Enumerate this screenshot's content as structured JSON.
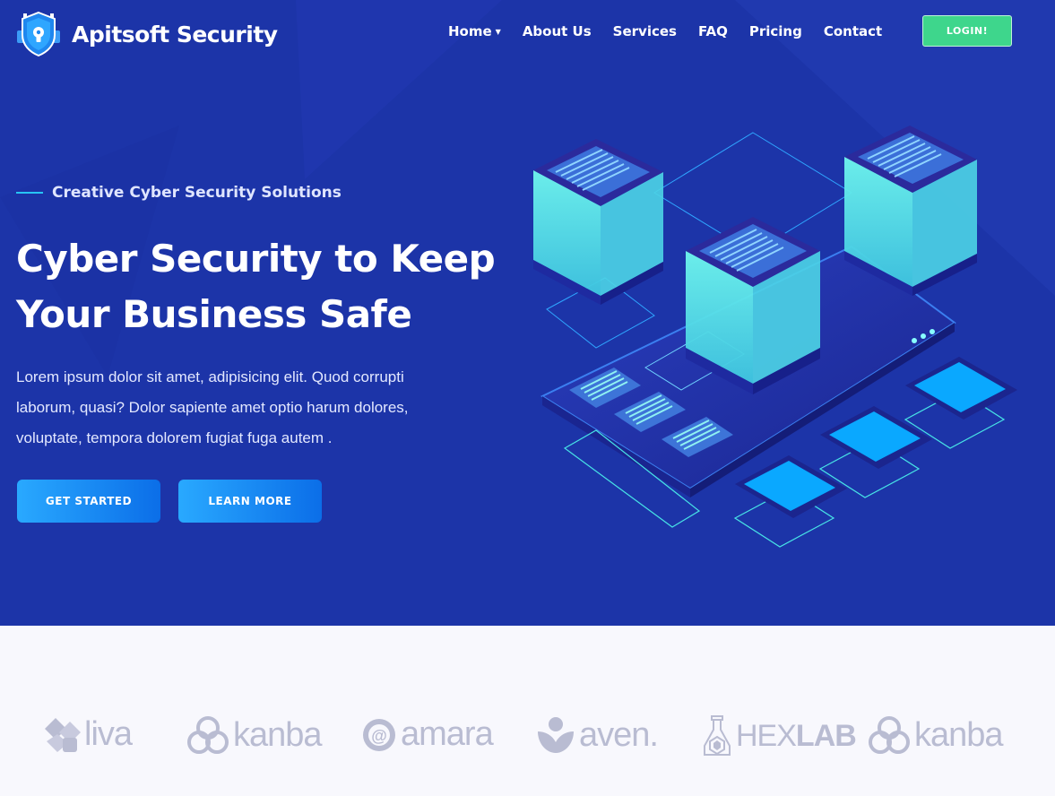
{
  "brand": {
    "name": "Apitsoft Security",
    "icon": "shield-lock-icon"
  },
  "nav": {
    "items": [
      {
        "label": "Home",
        "has_dropdown": true
      },
      {
        "label": "About Us"
      },
      {
        "label": "Services"
      },
      {
        "label": "FAQ"
      },
      {
        "label": "Pricing"
      },
      {
        "label": "Contact"
      }
    ],
    "login_label": "LOGIN!"
  },
  "hero": {
    "eyebrow": "Creative Cyber Security Solutions",
    "title_line1": "Cyber Security to Keep",
    "title_line2": "Your Business Safe",
    "paragraph_line1": "Lorem ipsum dolor sit amet, adipisicing elit. Quod corrupti",
    "paragraph_line2": "laborum, quasi? Dolor sapiente amet optio harum dolores,",
    "paragraph_line3": "voluptate, tempora dolorem fugiat fuga autem .",
    "primary_button": "GET STARTED",
    "secondary_button": "LEARN MORE"
  },
  "partners": [
    {
      "name": "liva",
      "icon": "liva-logo-icon"
    },
    {
      "name": "kanba",
      "icon": "kanba-logo-icon"
    },
    {
      "name": "amara",
      "icon": "amara-logo-icon"
    },
    {
      "name": "aven.",
      "icon": "aven-logo-icon"
    },
    {
      "name": "HEX",
      "name_bold": "LAB",
      "icon": "hexlab-logo-icon"
    },
    {
      "name": "kanba",
      "icon": "kanba-logo-icon"
    }
  ],
  "colors": {
    "hero_bg": "#1c34a8",
    "accent_green": "#3ed68c",
    "accent_blue": "#1e8ff5",
    "cyan": "#5ef0e8",
    "partner_gray": "#b9bcd2"
  }
}
